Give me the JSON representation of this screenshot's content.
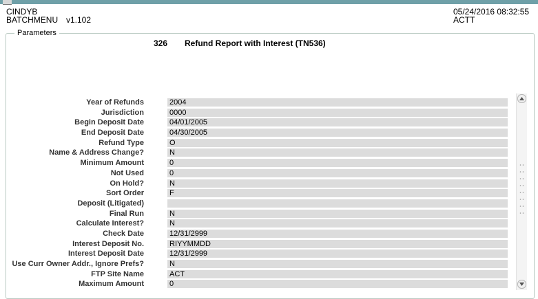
{
  "window": {
    "titlebar_color": "#6fa0a8"
  },
  "header": {
    "user": "CINDYB",
    "app": "BATCHMENU",
    "version": "v1.102",
    "datetime": "05/24/2016 08:32:55",
    "system": "ACTT"
  },
  "parameters": {
    "legend": "Parameters",
    "report_number": "326",
    "report_title": "Refund Report with Interest (TN536)",
    "fields": [
      {
        "label": "Year of Refunds",
        "value": "2004"
      },
      {
        "label": "Jurisdiction",
        "value": "0000"
      },
      {
        "label": "Begin Deposit Date",
        "value": "04/01/2005"
      },
      {
        "label": "End Deposit Date",
        "value": "04/30/2005"
      },
      {
        "label": "Refund Type",
        "value": "O"
      },
      {
        "label": "Name & Address Change?",
        "value": "N"
      },
      {
        "label": "Minimum Amount",
        "value": "0"
      },
      {
        "label": "Not Used",
        "value": "0"
      },
      {
        "label": "On Hold?",
        "value": "N"
      },
      {
        "label": "Sort Order",
        "value": "F"
      },
      {
        "label": "Deposit (Litigated)",
        "value": ""
      },
      {
        "label": "Final Run",
        "value": "N"
      },
      {
        "label": "Calculate Interest?",
        "value": "N"
      },
      {
        "label": "Check Date",
        "value": "12/31/2999"
      },
      {
        "label": "Interest Deposit No.",
        "value": "RIYYMMDD"
      },
      {
        "label": "Interest Deposit Date",
        "value": "12/31/2999"
      },
      {
        "label": "Use Curr Owner Addr., Ignore Prefs?",
        "value": "N"
      },
      {
        "label": "FTP Site Name",
        "value": "ACT"
      },
      {
        "label": "Maximum Amount",
        "value": "0"
      }
    ]
  }
}
